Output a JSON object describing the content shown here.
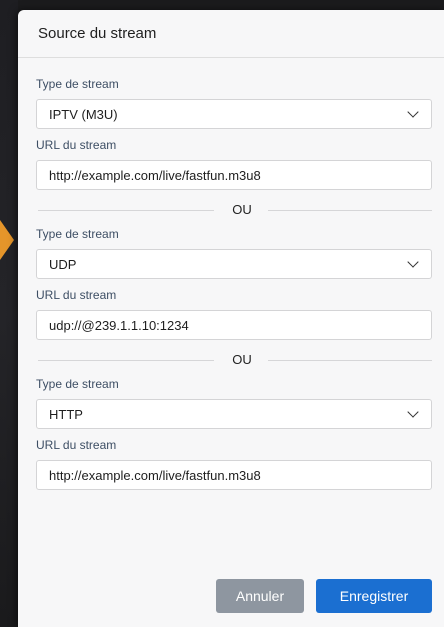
{
  "dialog": {
    "title": "Source du stream"
  },
  "sources": [
    {
      "type_label": "Type de stream",
      "type_value": "IPTV (M3U)",
      "url_label": "URL du stream",
      "url_value": "http://example.com/live/fastfun.m3u8"
    },
    {
      "type_label": "Type de stream",
      "type_value": "UDP",
      "url_label": "URL du stream",
      "url_value": "udp://@239.1.1.10:1234"
    },
    {
      "type_label": "Type de stream",
      "type_value": "HTTP",
      "url_label": "URL du stream",
      "url_value": "http://example.com/live/fastfun.m3u8"
    }
  ],
  "separator_text": "OU",
  "buttons": {
    "cancel": "Annuler",
    "save": "Enregistrer"
  },
  "colors": {
    "accent": "#1b6fd1",
    "cancel": "#8e96a0",
    "backdrop_chevron": "#e5952a"
  }
}
